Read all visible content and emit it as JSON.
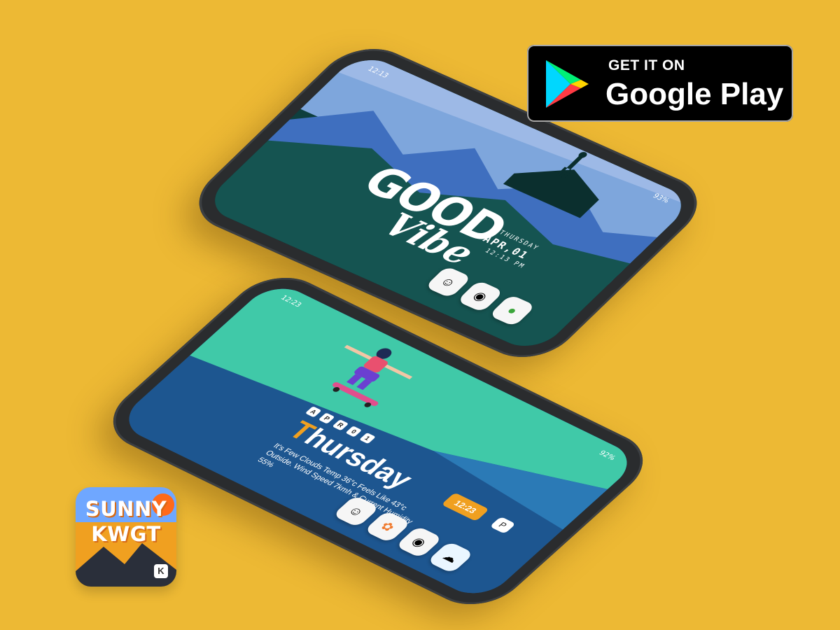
{
  "background_color": "#EDB934",
  "phone_top": {
    "status_time": "12:13",
    "status_battery": "93%",
    "headline_main": "GOOD",
    "headline_script": "Vibe",
    "day_label": "THURSDAY",
    "date_label": "APR,01",
    "time_label": "12:13 PM",
    "dock_icons": [
      "avatar-icon",
      "compass-icon",
      "leaf-icon"
    ],
    "accent_color": "#9bd04a"
  },
  "phone_bottom": {
    "status_time": "12:23",
    "status_battery": "92%",
    "date_chips": [
      "A",
      "P",
      "R",
      "0",
      "1"
    ],
    "day_title_first": "T",
    "day_title_rest": "hursday",
    "weather_text": "It's Few Clouds Temp 36°c Feels Like 43°c Outside. Wind Speed 7kmh & Current Humidity 55%",
    "time_pill": "12:23",
    "search_pill": "P",
    "dock_icons": [
      "avatar-icon",
      "palette-icon",
      "compass-icon",
      "cloud-icon"
    ],
    "accent_color": "#F0A020"
  },
  "google_play": {
    "small": "GET IT ON",
    "big": "Google Play"
  },
  "app_icon": {
    "line1": "SUNNY",
    "line2": "KWGT",
    "badge": "K"
  }
}
